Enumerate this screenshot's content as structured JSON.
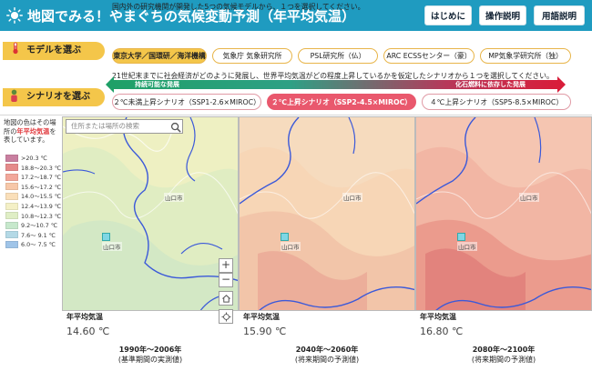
{
  "header": {
    "title": "地図でみる！やまぐちの気候変動予測（年平均気温）",
    "buttons": [
      "はじめに",
      "操作説明",
      "用語説明"
    ],
    "bg_color": "#1f9bc0"
  },
  "model": {
    "label": "モデルを選ぶ",
    "instruction": "国内外の研究機関が開発した5つの気候モデルから、１つを選択してください。",
    "options": [
      "東京大学／国環研／海洋機構",
      "気象庁 気象研究所",
      "PSL研究所（仏）",
      "ARC ECSSセンター（豪）",
      "MP気象学研究所（独）"
    ],
    "selected_index": 0
  },
  "scenario": {
    "label": "シナリオを選ぶ",
    "instruction": "21世紀末までに社会経済がどのように発展し、世界平均気温がどの程度上昇しているかを仮定したシナリオから１つを選択してください。",
    "gradient_left": "持続可能な発展",
    "gradient_right": "化石燃料に依存した発展",
    "options": [
      "２℃未満上昇シナリオ（SSP1-2.6×MIROC）",
      "２℃上昇シナリオ（SSP2-4.5×MIROC）",
      "４℃上昇シナリオ（SSP5-8.5×MIROC）"
    ],
    "selected_index": 1
  },
  "legend": {
    "desc_pre": "地図の色はその場所の",
    "desc_highlight": "年平均気温",
    "desc_post": "を表しています。",
    "items": [
      {
        "label": ">20.3 ℃",
        "color": "#c97fa0"
      },
      {
        "label": "18.8〜20.3 ℃",
        "color": "#e58a8a"
      },
      {
        "label": "17.2〜18.7 ℃",
        "color": "#f2a79a"
      },
      {
        "label": "15.6〜17.2 ℃",
        "color": "#f7c7a8"
      },
      {
        "label": "14.0〜15.5 ℃",
        "color": "#fadfb9"
      },
      {
        "label": "12.4〜13.9 ℃",
        "color": "#f4f0c6"
      },
      {
        "label": "10.8〜12.3 ℃",
        "color": "#dfeec5"
      },
      {
        "label": "9.2〜10.7 ℃",
        "color": "#c6e8cc"
      },
      {
        "label": "7.6〜 9.1 ℃",
        "color": "#b4d9e6"
      },
      {
        "label": "6.0〜 7.5 ℃",
        "color": "#9fc4e8"
      }
    ]
  },
  "map": {
    "search_placeholder": "住所または場所の検索",
    "zoom_in": "+",
    "zoom_out": "−",
    "city_label": "山口市",
    "panels": [
      {
        "label": "年平均気温",
        "value": "14.60 ℃",
        "period": "1990年〜2006年",
        "note": "(基準期間の実測値)"
      },
      {
        "label": "年平均気温",
        "value": "15.90 ℃",
        "period": "2040年〜2060年",
        "note": "(将来期間の予測値)"
      },
      {
        "label": "年平均気温",
        "value": "16.80 ℃",
        "period": "2080年〜2100年",
        "note": "(将来期間の予測値)"
      }
    ]
  }
}
